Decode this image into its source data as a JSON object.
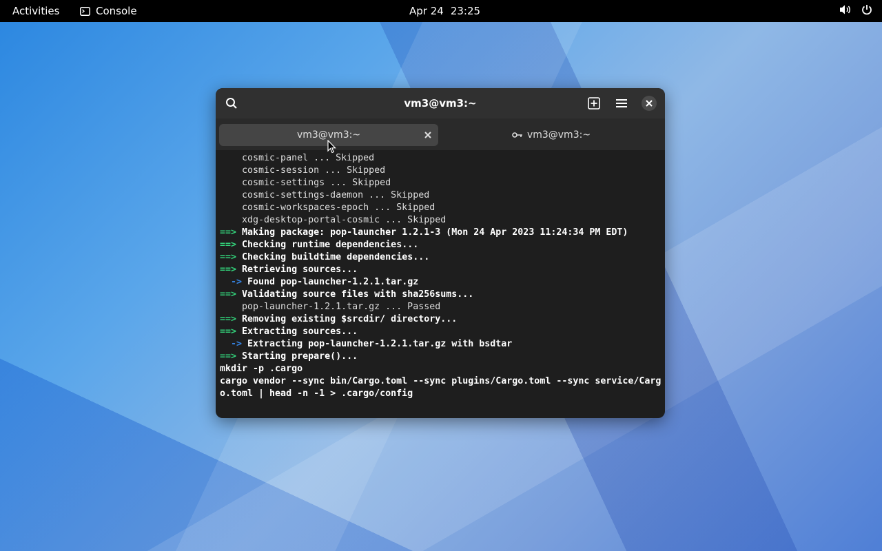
{
  "topbar": {
    "activities": "Activities",
    "app_name": "Console",
    "date": "Apr 24",
    "time": "23:25"
  },
  "window": {
    "title": "vm3@vm3:~",
    "tabs": [
      {
        "label": "vm3@vm3:~",
        "active": true
      },
      {
        "label": "vm3@vm3:~",
        "active": false,
        "icon": "key-icon"
      }
    ]
  },
  "terminal": {
    "lines": [
      {
        "prefix": "",
        "text": "    cosmic-panel ... Skipped",
        "bold": false
      },
      {
        "prefix": "",
        "text": "    cosmic-session ... Skipped",
        "bold": false
      },
      {
        "prefix": "",
        "text": "    cosmic-settings ... Skipped",
        "bold": false
      },
      {
        "prefix": "",
        "text": "    cosmic-settings-daemon ... Skipped",
        "bold": false
      },
      {
        "prefix": "",
        "text": "    cosmic-workspaces-epoch ... Skipped",
        "bold": false
      },
      {
        "prefix": "",
        "text": "    xdg-desktop-portal-cosmic ... Skipped",
        "bold": false
      },
      {
        "prefix": "==>",
        "text": " Making package: pop-launcher 1.2.1-3 (Mon 24 Apr 2023 11:24:34 PM EDT)",
        "bold": true
      },
      {
        "prefix": "==>",
        "text": " Checking runtime dependencies...",
        "bold": true
      },
      {
        "prefix": "==>",
        "text": " Checking buildtime dependencies...",
        "bold": true
      },
      {
        "prefix": "==>",
        "text": " Retrieving sources...",
        "bold": true
      },
      {
        "prefix": "  ->",
        "text": " Found pop-launcher-1.2.1.tar.gz",
        "bold": true
      },
      {
        "prefix": "==>",
        "text": " Validating source files with sha256sums...",
        "bold": true
      },
      {
        "prefix": "",
        "text": "    pop-launcher-1.2.1.tar.gz ... Passed",
        "bold": false
      },
      {
        "prefix": "==>",
        "text": " Removing existing $srcdir/ directory...",
        "bold": true
      },
      {
        "prefix": "==>",
        "text": " Extracting sources...",
        "bold": true
      },
      {
        "prefix": "  ->",
        "text": " Extracting pop-launcher-1.2.1.tar.gz with bsdtar",
        "bold": true
      },
      {
        "prefix": "==>",
        "text": " Starting prepare()...",
        "bold": true
      },
      {
        "prefix": "",
        "text": "mkdir -p .cargo",
        "bold": true
      },
      {
        "prefix": "",
        "text": "cargo vendor --sync bin/Cargo.toml --sync plugins/Cargo.toml --sync service/Carg",
        "bold": true
      },
      {
        "prefix": "",
        "text": "o.toml | head -n -1 > .cargo/config",
        "bold": true
      }
    ]
  }
}
